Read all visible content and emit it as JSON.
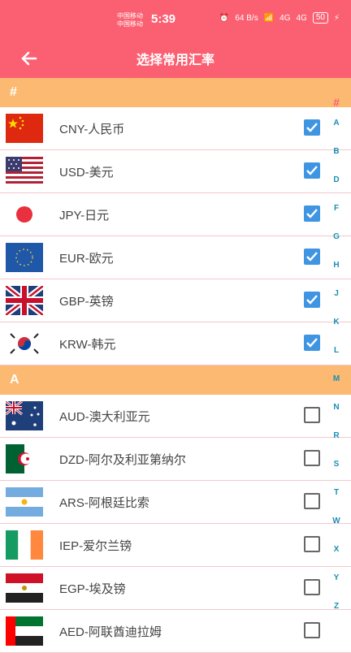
{
  "status_bar": {
    "carrier1": "中国移动",
    "carrier2": "中国移动",
    "time": "5:39",
    "net_speed": "64 B/s",
    "signal1": "4G",
    "signal2": "4G",
    "battery": "50"
  },
  "header": {
    "title": "选择常用汇率",
    "back_icon": "arrow-left-icon"
  },
  "sections": [
    {
      "label": "#",
      "items": [
        {
          "label": "CNY-人民币",
          "flag": "china-flag-icon",
          "checked": true
        },
        {
          "label": "USD-美元",
          "flag": "usa-flag-icon",
          "checked": true
        },
        {
          "label": "JPY-日元",
          "flag": "japan-flag-icon",
          "checked": true
        },
        {
          "label": "EUR-欧元",
          "flag": "eu-flag-icon",
          "checked": true
        },
        {
          "label": "GBP-英镑",
          "flag": "uk-flag-icon",
          "checked": true
        },
        {
          "label": "KRW-韩元",
          "flag": "korea-flag-icon",
          "checked": true
        }
      ]
    },
    {
      "label": "A",
      "items": [
        {
          "label": "AUD-澳大利亚元",
          "flag": "australia-flag-icon",
          "checked": false
        },
        {
          "label": "DZD-阿尔及利亚第纳尔",
          "flag": "algeria-flag-icon",
          "checked": false
        },
        {
          "label": "ARS-阿根廷比索",
          "flag": "argentina-flag-icon",
          "checked": false
        },
        {
          "label": "IEP-爱尔兰镑",
          "flag": "ireland-flag-icon",
          "checked": false
        },
        {
          "label": "EGP-埃及镑",
          "flag": "egypt-flag-icon",
          "checked": false
        },
        {
          "label": "AED-阿联酋迪拉姆",
          "flag": "uae-flag-icon",
          "checked": false
        }
      ]
    }
  ],
  "index_bar": [
    "#",
    "A",
    "B",
    "D",
    "F",
    "G",
    "H",
    "J",
    "K",
    "L",
    "M",
    "N",
    "R",
    "S",
    "T",
    "W",
    "X",
    "Y",
    "Z"
  ],
  "colors": {
    "primary": "#fb6072",
    "section": "#fbb971",
    "checkbox": "#3f95e2",
    "index": "#1a8fb4"
  }
}
